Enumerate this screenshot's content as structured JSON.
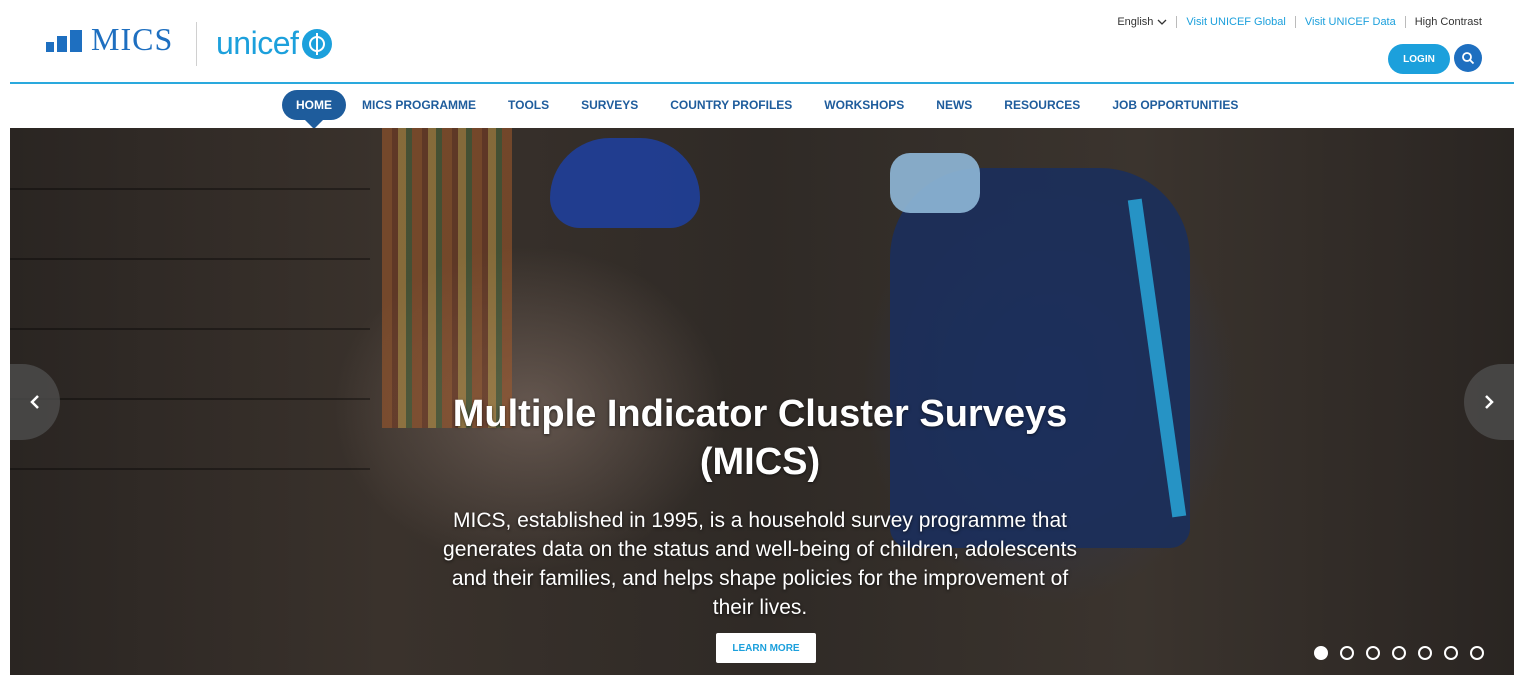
{
  "header": {
    "mics_logo_text": "MICS",
    "unicef_logo_text": "unicef",
    "language": "English",
    "links": [
      "Visit UNICEF Global",
      "Visit UNICEF Data"
    ],
    "high_contrast": "High Contrast",
    "login_label": "LOGIN"
  },
  "nav": {
    "items": [
      {
        "label": "HOME",
        "active": true
      },
      {
        "label": "MICS PROGRAMME"
      },
      {
        "label": "TOOLS"
      },
      {
        "label": "SURVEYS"
      },
      {
        "label": "COUNTRY PROFILES"
      },
      {
        "label": "WORKSHOPS"
      },
      {
        "label": "NEWS"
      },
      {
        "label": "RESOURCES"
      },
      {
        "label": "JOB OPPORTUNITIES"
      }
    ]
  },
  "hero": {
    "title": "Multiple Indicator Cluster Surveys (MICS)",
    "description": "MICS, established in 1995, is a household survey programme that generates data on the status and well-being of children, adolescents and their families, and helps shape policies for the improvement of their lives.",
    "cta_label": "LEARN MORE",
    "slide_count": 7,
    "active_slide": 1
  },
  "colors": {
    "accent": "#1ca0dc",
    "nav_blue": "#1e5c9c",
    "brand_dark": "#1e6fc0"
  }
}
